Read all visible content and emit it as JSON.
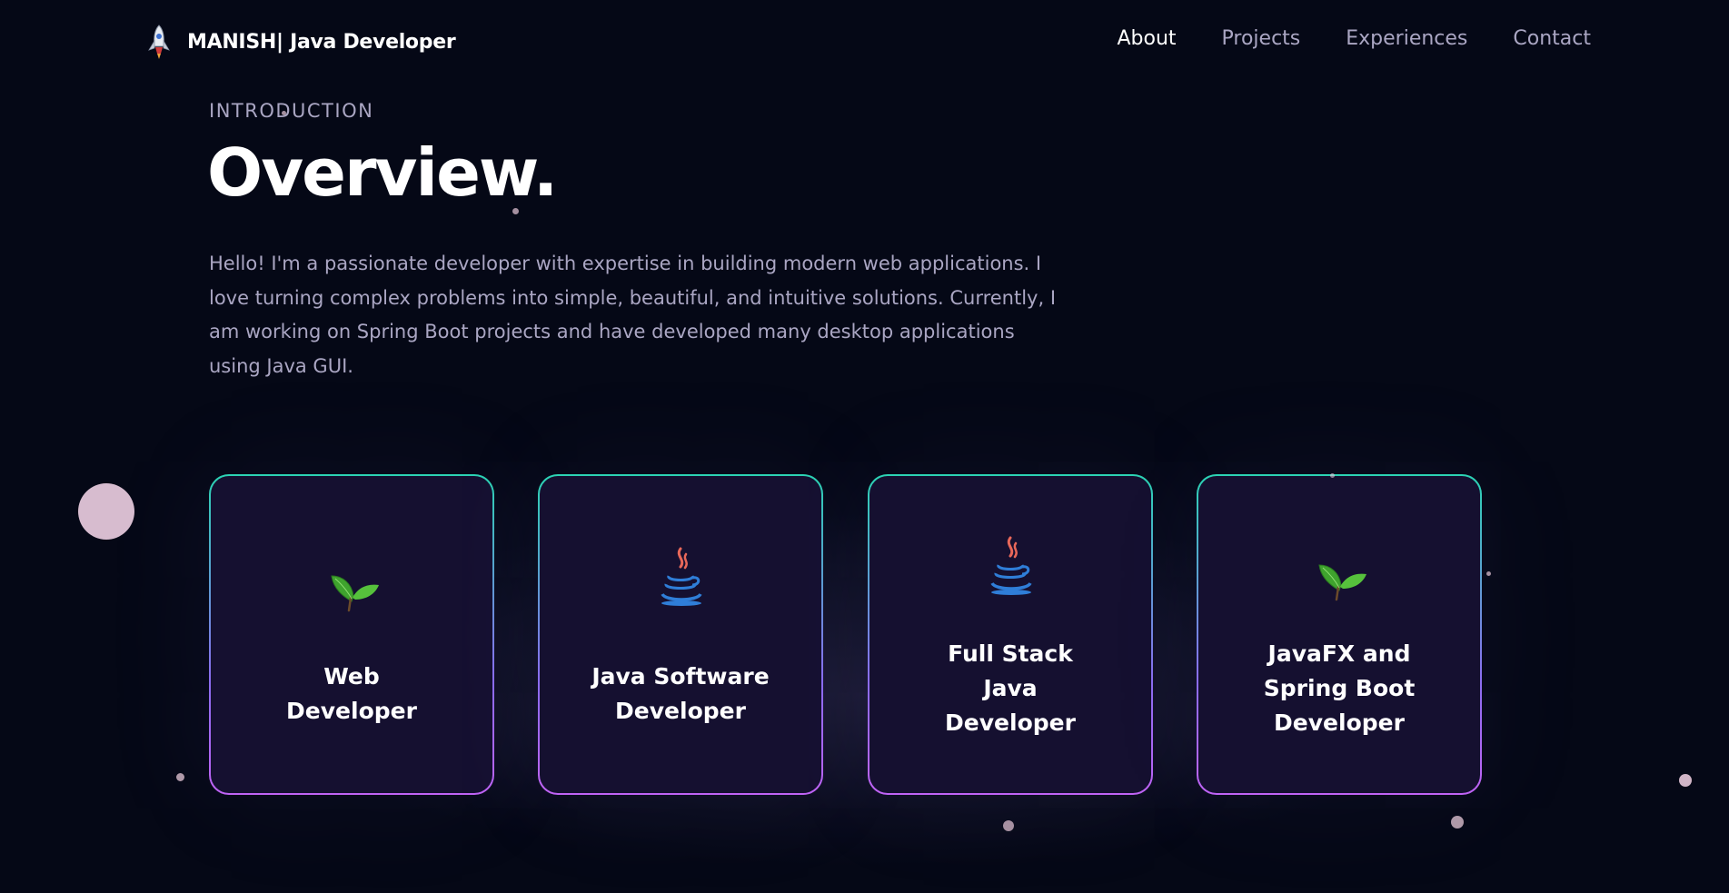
{
  "navbar": {
    "brand_text": "MANISH| Java Developer",
    "links": [
      {
        "label": "About",
        "active": true
      },
      {
        "label": "Projects",
        "active": false
      },
      {
        "label": "Experiences",
        "active": false
      },
      {
        "label": "Contact",
        "active": false
      }
    ]
  },
  "intro": {
    "subtitle": "INTRODUCTION",
    "title": "Overview.",
    "text": "Hello! I'm a passionate developer with expertise in building modern web applications. I love turning complex problems into simple, beautiful, and intuitive solutions. Currently, I am working on Spring Boot projects and have developed many desktop applications using Java GUI."
  },
  "services": [
    {
      "title": "Web Developer",
      "icon": "leaf-icon"
    },
    {
      "title": "Java Software Developer",
      "icon": "java-icon"
    },
    {
      "title": "Full Stack Java Developer",
      "icon": "java-icon"
    },
    {
      "title": "JavaFX and Spring Boot Developer",
      "icon": "leaf-icon"
    }
  ],
  "colors": {
    "background": "#050816",
    "card_background": "#151030",
    "secondary_text": "#aaa6c3",
    "card_border_top": "#2bd4b4",
    "card_border_bottom": "#c063f5"
  }
}
